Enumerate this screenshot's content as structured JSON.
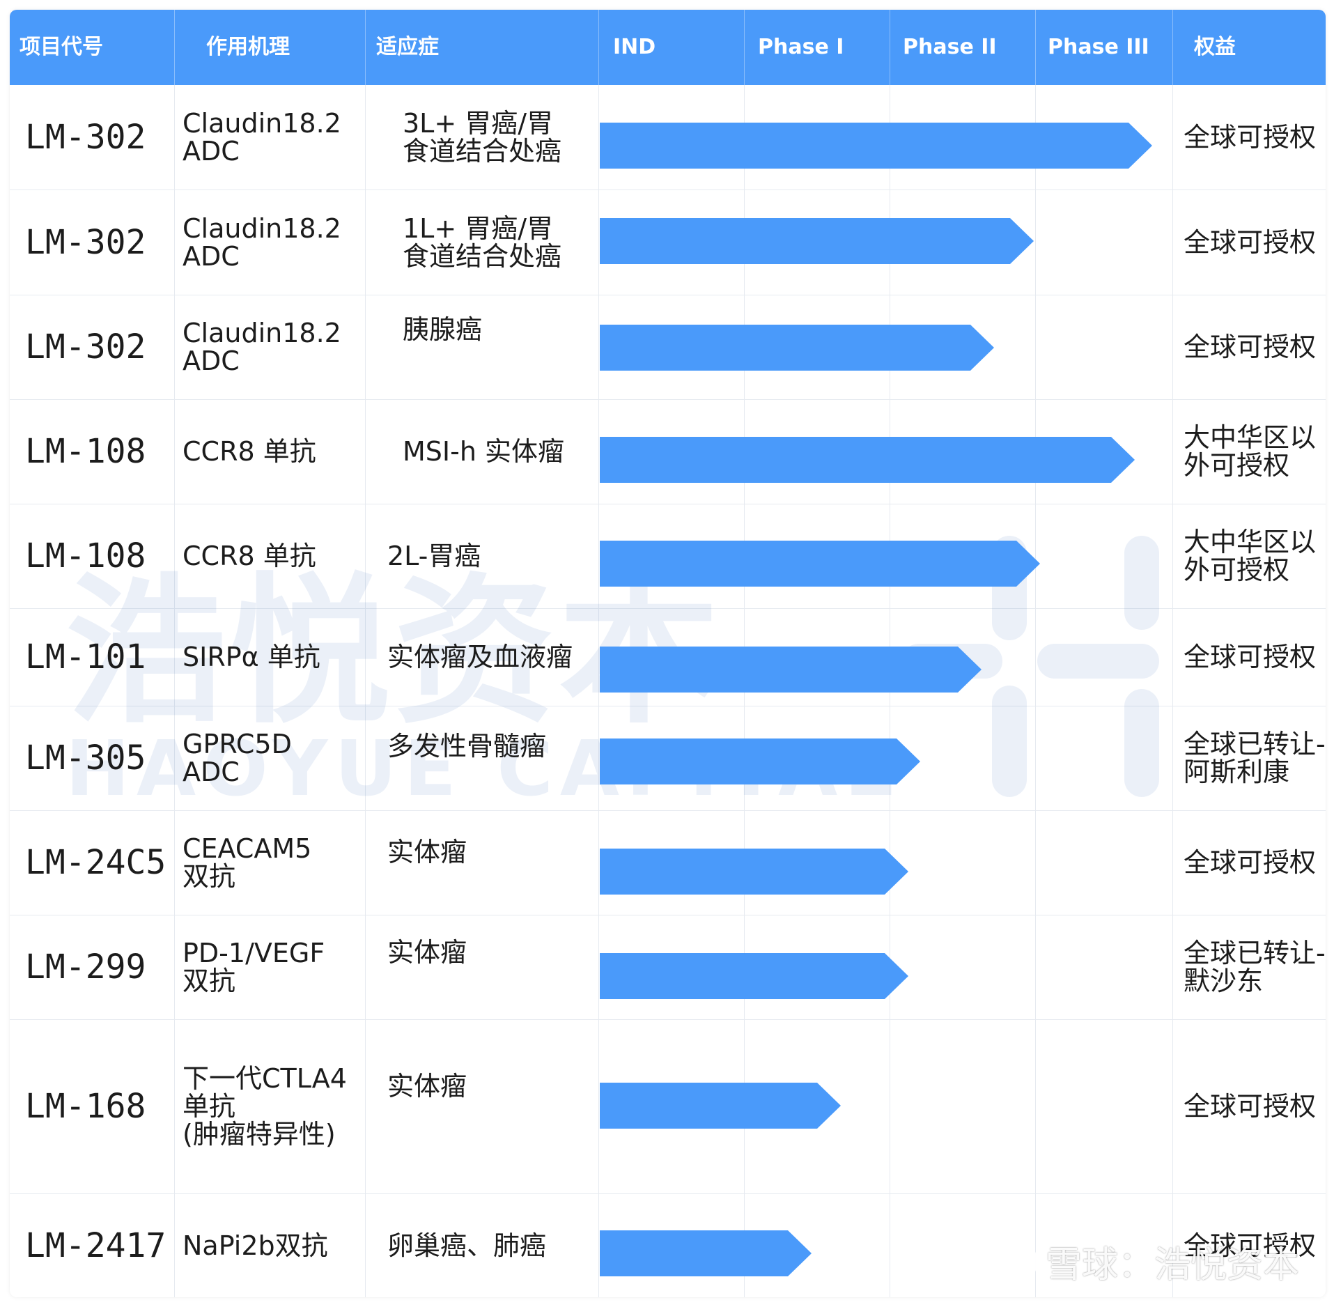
{
  "header": {
    "code": "项目代号",
    "mechanism": "作用机理",
    "indication": "适应症",
    "ind": "IND",
    "phase1": "Phase I",
    "phase2": "Phase II",
    "phase3": "Phase III",
    "rights": "权益"
  },
  "rows": [
    {
      "code": "LM-302",
      "mechanism": "Claudin18.2\nADC",
      "indication": "3L+ 胃癌/胃\n食道结合处癌",
      "progress_end": "Phase III (complete)",
      "rights": "全球可授权"
    },
    {
      "code": "LM-302",
      "mechanism": "Claudin18.2\nADC",
      "indication": "1L+ 胃癌/胃\n食道结合处癌",
      "progress_end": "Phase II (complete)",
      "rights": "全球可授权"
    },
    {
      "code": "LM-302",
      "mechanism": "Claudin18.2\nADC",
      "indication": "胰腺癌",
      "progress_end": "Phase II",
      "rights": "全球可授权"
    },
    {
      "code": "LM-108",
      "mechanism": "CCR8 单抗",
      "indication": "MSI-h 实体瘤",
      "progress_end": "Phase III",
      "rights": "大中华区以\n外可授权"
    },
    {
      "code": "LM-108",
      "mechanism": "CCR8 单抗",
      "indication": "2L-胃癌",
      "progress_end": "Phase II (complete)",
      "rights": "大中华区以\n外可授权"
    },
    {
      "code": "LM-101",
      "mechanism": "SIRPα 单抗",
      "indication": "实体瘤及血液瘤",
      "progress_end": "Phase II",
      "rights": "全球可授权"
    },
    {
      "code": "LM-305",
      "mechanism": "GPRC5D\nADC",
      "indication": "多发性骨髓瘤",
      "progress_end": "Phase I (complete)",
      "rights": "全球已转让-\n阿斯利康"
    },
    {
      "code": "LM-24C5",
      "mechanism": "CEACAM5\n双抗",
      "indication": "实体瘤",
      "progress_end": "Phase I",
      "rights": "全球可授权"
    },
    {
      "code": "LM-299",
      "mechanism": "PD-1/VEGF\n双抗",
      "indication": "实体瘤",
      "progress_end": "Phase I",
      "rights": "全球已转让-\n默沙东"
    },
    {
      "code": "LM-168",
      "mechanism": "下一代CTLA4\n单抗\n(肿瘤特异性)",
      "indication": "实体瘤",
      "progress_end": "Phase I",
      "rights": "全球可授权"
    },
    {
      "code": "LM-2417",
      "mechanism": "NaPi2b双抗",
      "indication": "卵巢癌、肺癌",
      "progress_end": "IND",
      "rights": "全球可授权"
    }
  ],
  "watermark": {
    "main": "浩悦资本",
    "sub": "HAOYUE CAPITAL",
    "footer": "雪球：浩悦资本"
  },
  "colors": {
    "accent": "#4a9afa",
    "grid": "#e6eaf0"
  },
  "icons": [
    "xueqiu-logo-icon",
    "haoyue-logo-icon"
  ]
}
